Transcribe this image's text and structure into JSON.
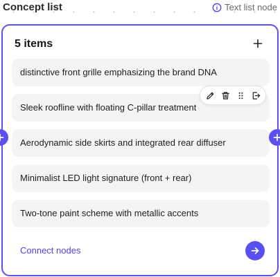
{
  "node": {
    "title": "Concept list",
    "type_label": "Text list node"
  },
  "card": {
    "count_label": "5 items",
    "items": [
      {
        "label": "distinctive front grille emphasizing the brand DNA"
      },
      {
        "label": "Sleek roofline with floating C-pillar treatment"
      },
      {
        "label": "Aerodynamic side skirts and integrated rear diffuser"
      },
      {
        "label": "Minimalist LED light signature (front + rear)"
      },
      {
        "label": "Two-tone paint scheme with metallic accents"
      }
    ],
    "item_toolbar": {
      "actions": [
        "pencil-icon",
        "trash-icon",
        "drag-handle-icon",
        "move-out-icon"
      ]
    },
    "footer": {
      "connect_label": "Connect nodes"
    }
  },
  "colors": {
    "accent": "#5a4ff0",
    "link": "#4f46e5",
    "item_bg": "#f4f4f5"
  }
}
